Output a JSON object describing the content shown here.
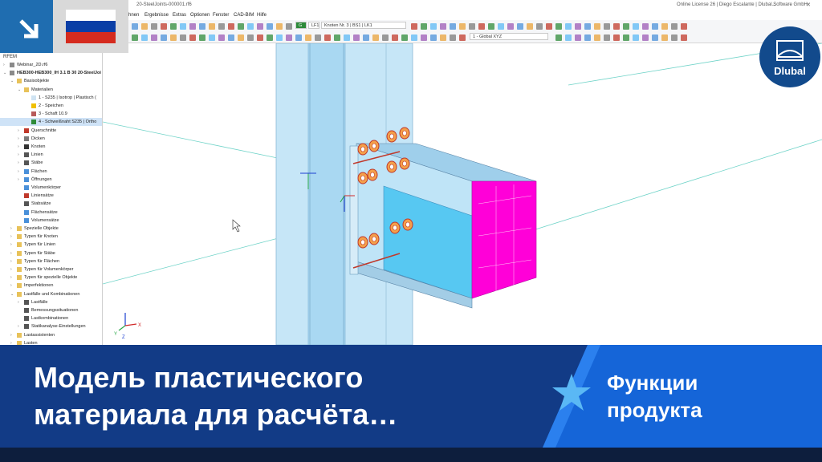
{
  "window": {
    "title": "20-SteelJoints-000001.rf6",
    "license": "Online License 26 | Diego Escalante | Dlubal Software GmbH",
    "controls": "– ▫ ✕"
  },
  "menu": [
    "hnen",
    "Ergebnisse",
    "Extras",
    "Optionen",
    "Fenster",
    "CAD-BIM",
    "Hilfe"
  ],
  "toolbar": {
    "loadcase_tag": "G",
    "loadcase_id": "LF1",
    "loadcase_name": "Knoten Nr. 3 | BS1 | LK1",
    "coord_system": "1 - Global XYZ"
  },
  "navigator": {
    "title": "RFEM",
    "items": [
      {
        "label": "Webinar_2D.rf6",
        "level": 1,
        "exp": ">",
        "color": "#8a8a8a"
      },
      {
        "label": "HEB300-HEB300_IH 3.1 B 30 20-SteelJoi",
        "level": 1,
        "exp": "v",
        "color": "#8a8a8a",
        "bold": true
      },
      {
        "label": "Basisobjekte",
        "level": 2,
        "exp": "v",
        "color": "#e8c25a"
      },
      {
        "label": "Materialien",
        "level": 3,
        "exp": "v",
        "color": "#e8c25a"
      },
      {
        "label": "1 - S235 | Isotrop | Plastisch (",
        "level": 4,
        "exp": "",
        "color": "#cfe3f2"
      },
      {
        "label": "2 - Speichen",
        "level": 4,
        "exp": "",
        "color": "#f0c000"
      },
      {
        "label": "3 - Schaft 10.9",
        "level": 4,
        "exp": "",
        "color": "#b85a5a"
      },
      {
        "label": "4 - Schweißnaht S235 | Ortho",
        "level": 4,
        "exp": "",
        "color": "#2e8b3a",
        "selected": true
      },
      {
        "label": "Querschnitte",
        "level": 3,
        "exp": ">",
        "color": "#c0392b"
      },
      {
        "label": "Dicken",
        "level": 3,
        "exp": ">",
        "color": "#7a7a7a"
      },
      {
        "label": "Knoten",
        "level": 3,
        "exp": ">",
        "color": "#333333"
      },
      {
        "label": "Linien",
        "level": 3,
        "exp": ">",
        "color": "#555555"
      },
      {
        "label": "Stäbe",
        "level": 3,
        "exp": ">",
        "color": "#555555"
      },
      {
        "label": "Flächen",
        "level": 3,
        "exp": ">",
        "color": "#4a90d9"
      },
      {
        "label": "Öffnungen",
        "level": 3,
        "exp": ">",
        "color": "#4a90d9"
      },
      {
        "label": "Volumenkörper",
        "level": 3,
        "exp": "",
        "color": "#4a90d9"
      },
      {
        "label": "Liniensätze",
        "level": 3,
        "exp": "",
        "color": "#c0392b"
      },
      {
        "label": "Stabsätze",
        "level": 3,
        "exp": "",
        "color": "#555555"
      },
      {
        "label": "Flächensätze",
        "level": 3,
        "exp": "",
        "color": "#4a90d9"
      },
      {
        "label": "Volumensätze",
        "level": 3,
        "exp": "",
        "color": "#4a90d9"
      },
      {
        "label": "Spezielle Objekte",
        "level": 2,
        "exp": ">",
        "color": "#e8c25a"
      },
      {
        "label": "Typen für Knoten",
        "level": 2,
        "exp": ">",
        "color": "#e8c25a"
      },
      {
        "label": "Typen für Linien",
        "level": 2,
        "exp": ">",
        "color": "#e8c25a"
      },
      {
        "label": "Typen für Stäbe",
        "level": 2,
        "exp": ">",
        "color": "#e8c25a"
      },
      {
        "label": "Typen für Flächen",
        "level": 2,
        "exp": ">",
        "color": "#e8c25a"
      },
      {
        "label": "Typen für Volumenkörper",
        "level": 2,
        "exp": ">",
        "color": "#e8c25a"
      },
      {
        "label": "Typen für spezielle Objekte",
        "level": 2,
        "exp": ">",
        "color": "#e8c25a"
      },
      {
        "label": "Imperfektionen",
        "level": 2,
        "exp": ">",
        "color": "#e8c25a"
      },
      {
        "label": "Lastfälle und Kombinationen",
        "level": 2,
        "exp": "v",
        "color": "#e8c25a"
      },
      {
        "label": "Lastfälle",
        "level": 3,
        "exp": ">",
        "color": "#555555"
      },
      {
        "label": "Bemessungssituationen",
        "level": 3,
        "exp": "",
        "color": "#555555"
      },
      {
        "label": "Lastkombinationen",
        "level": 3,
        "exp": "",
        "color": "#555555"
      },
      {
        "label": "Statikanalyse-Einstellungen",
        "level": 3,
        "exp": ">",
        "color": "#555555"
      },
      {
        "label": "Lastassistenten",
        "level": 2,
        "exp": ">",
        "color": "#e8c25a"
      },
      {
        "label": "Lasten",
        "level": 2,
        "exp": ">",
        "color": "#e8c25a"
      }
    ]
  },
  "viewport": {
    "axis_labels": {
      "x": "X",
      "y": "Y",
      "z": "Z"
    },
    "colors": {
      "column": "#c6e6f7",
      "flange": "#9fd0ec",
      "web_face": "#57c8f2",
      "weld_face": "#ff00d8"
    }
  },
  "brand": {
    "logo_text": "Dlubal",
    "corner_color": "#1f6db0",
    "flag_colors": [
      "#ffffff",
      "#0a3ea6",
      "#d52b1e"
    ]
  },
  "banner": {
    "title_line1": "Модель пластического",
    "title_line2": "материала для расчёта…",
    "category_line1": "Функции",
    "category_line2": "продукта"
  }
}
